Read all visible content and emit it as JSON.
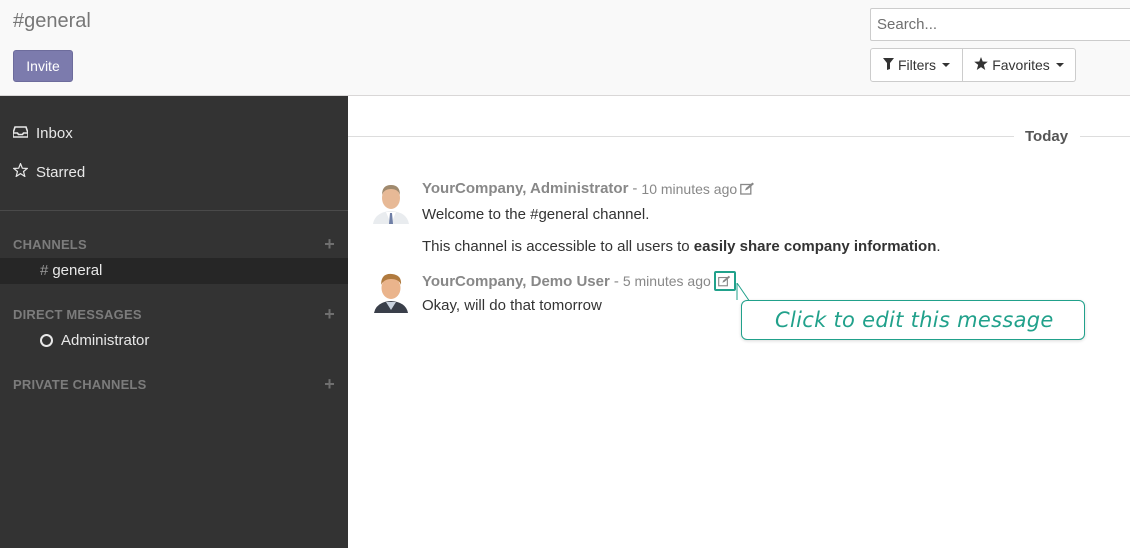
{
  "header": {
    "title": "#general",
    "invite_label": "Invite",
    "search_placeholder": "Search...",
    "filters_label": "Filters",
    "favorites_label": "Favorites"
  },
  "sidebar": {
    "inbox_label": "Inbox",
    "starred_label": "Starred",
    "channels_header": "CHANNELS",
    "channels": [
      {
        "hash": "#",
        "name": "general"
      }
    ],
    "dm_header": "DIRECT MESSAGES",
    "direct_messages": [
      {
        "name": "Administrator"
      }
    ],
    "private_header": "PRIVATE CHANNELS",
    "plus": "+"
  },
  "thread": {
    "date_label": "Today",
    "messages": [
      {
        "author": "YourCompany, Administrator",
        "dash": "-",
        "time": "10 minutes ago",
        "lines": [
          "Welcome to the #general channel."
        ],
        "line2_prefix": "This channel is accessible to all users to ",
        "line2_bold": "easily share company information",
        "line2_suffix": "."
      },
      {
        "author": "YourCompany, Demo User",
        "dash": "-",
        "time": "5 minutes ago",
        "lines": [
          "Okay, will do that tomorrow"
        ]
      }
    ]
  },
  "tooltip": {
    "text": "Click to edit this message"
  },
  "colors": {
    "accent": "#7c7bad",
    "sidebar_bg": "#333333",
    "tip_green": "#21a18b"
  }
}
